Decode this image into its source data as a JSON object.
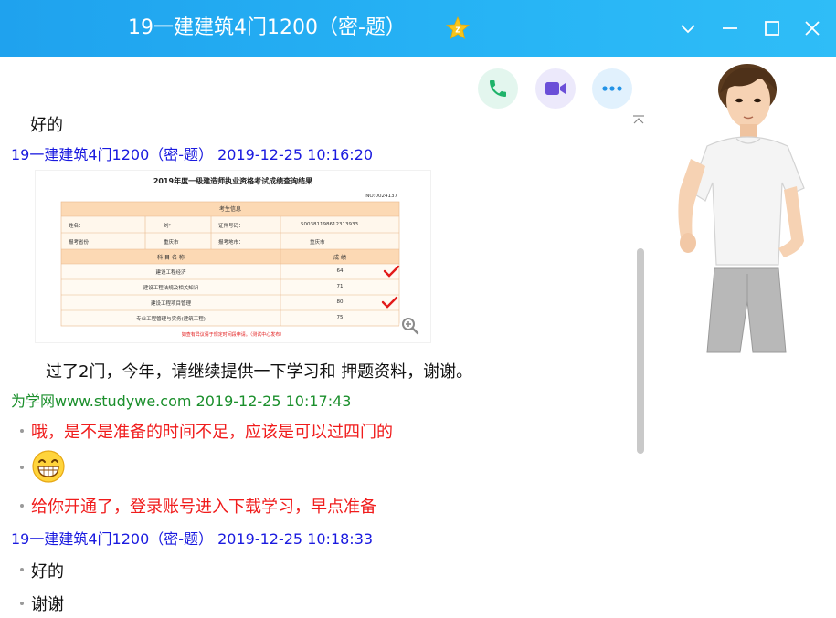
{
  "window": {
    "title": "19一建建筑4门1200（密-题）",
    "badge_letter": "z",
    "accent": "#22aaf0"
  },
  "toolbar": {
    "call_icon": "phone-icon",
    "video_icon": "video-camera-icon",
    "more_icon": "more-dots-icon"
  },
  "messages": [
    {
      "text": "好的"
    },
    {
      "header": "19一建建筑4门1200（密-题） 2019-12-25 10:16:20"
    },
    {
      "image": {
        "title": "2019年度一级建造师执业资格考试成绩查询结果",
        "code": "NO:0024137",
        "section": "考生信息",
        "row1": [
          "姓名：",
          "刘*",
          "证件号码：",
          "500381198612313933"
        ],
        "row2": [
          "报考省份：",
          "重庆市",
          "报考地市：",
          "重庆市"
        ],
        "col_subject": "科 目 名 称",
        "col_score": "成 绩",
        "subjects": [
          {
            "name": "建设工程经济",
            "score": "64"
          },
          {
            "name": "建设工程法规及相关知识",
            "score": "71"
          },
          {
            "name": "建设工程项目管理",
            "score": "80"
          },
          {
            "name": "专业工程管理与实务(建筑工程)",
            "score": "75"
          }
        ],
        "footnote": "如查有异议请于规定时间段申请。（测试中心发布）"
      }
    },
    {
      "text": "过了2门，今年，请继续提供一下学习和 押题资料，谢谢。"
    },
    {
      "header": "为学网www.studywe.com 2019-12-25 10:17:43"
    },
    {
      "text": "哦，是不是准备的时间不足，应该是可以过四门的"
    },
    {
      "emoji": "grinning-face-icon"
    },
    {
      "text": "给你开通了，登录账号进入下载学习，早点准备"
    },
    {
      "header": "19一建建筑4门1200（密-题） 2019-12-25 10:18:33"
    },
    {
      "text": "好的"
    },
    {
      "text": "谢谢"
    }
  ]
}
